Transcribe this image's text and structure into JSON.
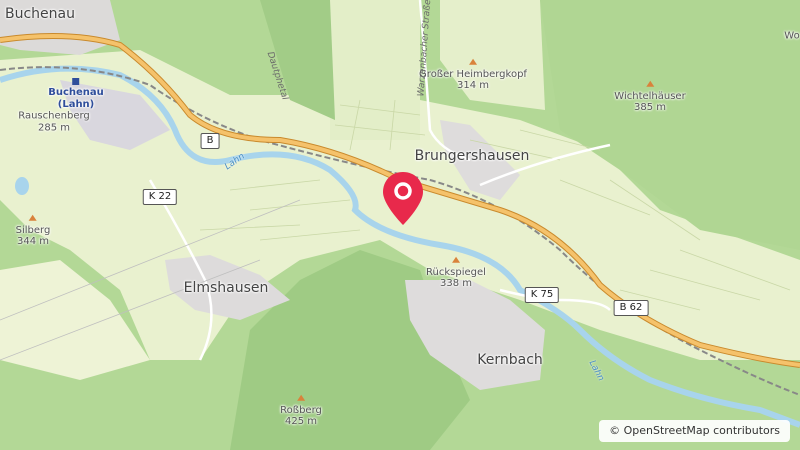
{
  "towns": [
    {
      "id": "buchenau",
      "name": "Buchenau"
    },
    {
      "id": "brungershausen",
      "name": "Brungershausen"
    },
    {
      "id": "elmshausen",
      "name": "Elmshausen"
    },
    {
      "id": "kernbach",
      "name": "Kernbach"
    }
  ],
  "station": {
    "line1": "Buchenau",
    "line2": "(Lahn)"
  },
  "peaks": [
    {
      "id": "rauschenberg",
      "name": "Rauschenberg",
      "elevation": "285 m"
    },
    {
      "id": "silberg",
      "name": "Silberg",
      "elevation": "344 m"
    },
    {
      "id": "grosser-heimbergkopf",
      "name": "Großer Heimbergkopf",
      "elevation": "314 m"
    },
    {
      "id": "wichtelhauser",
      "name": "Wichtelhäuser",
      "elevation": "385 m"
    },
    {
      "id": "ruckspiegel",
      "name": "Rückspiegel",
      "elevation": "338 m"
    },
    {
      "id": "rossberg",
      "name": "Roßberg",
      "elevation": "425 m"
    }
  ],
  "roads": {
    "k22": "K 22",
    "k75": "K 75",
    "b62": "B 62",
    "b_cut": "B",
    "street": "Warzenbacher Straße",
    "valley": "Dautphetal"
  },
  "rivers": {
    "lahn1": "Lahn",
    "lahn2": "Lahn"
  },
  "edge_label": "Wo",
  "attribution": "© OpenStreetMap contributors",
  "colors": {
    "forest": "#a9d08e",
    "meadow": "#e9f1cf",
    "urban": "#dedcdc",
    "water": "#a8d4ec",
    "main_road": "#f5b041",
    "pin": "#e8294b"
  }
}
